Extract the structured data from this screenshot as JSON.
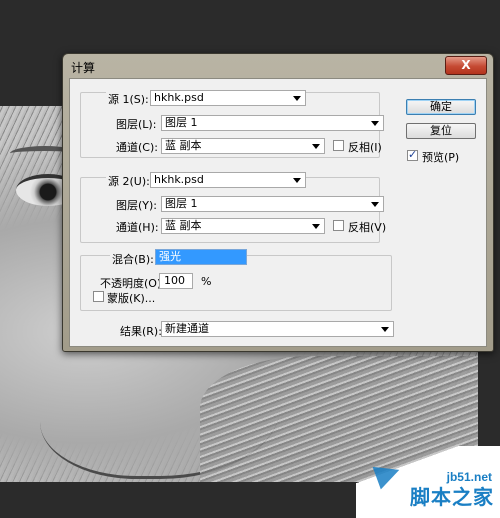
{
  "dialog": {
    "title": "计算",
    "close_label": "X"
  },
  "source1": {
    "label": "源 1(S):",
    "file": "hkhk.psd",
    "layer_label": "图层(L):",
    "layer": "图层 1",
    "channel_label": "通道(C):",
    "channel": "蓝 副本",
    "invert_label": "反相(I)",
    "invert_checked": false
  },
  "source2": {
    "label": "源 2(U):",
    "file": "hkhk.psd",
    "layer_label": "图层(Y):",
    "layer": "图层 1",
    "channel_label": "通道(H):",
    "channel": "蓝 副本",
    "invert_label": "反相(V)",
    "invert_checked": false
  },
  "blend": {
    "label": "混合(B):",
    "mode": "强光",
    "opacity_label": "不透明度(O):",
    "opacity_value": "100",
    "opacity_unit": "%",
    "mask_label": "蒙版(K)...",
    "mask_checked": false
  },
  "result": {
    "label": "结果(R):",
    "value": "新建通道"
  },
  "buttons": {
    "ok": "确定",
    "reset": "复位",
    "preview": "预览(P)",
    "preview_checked": true
  },
  "watermark": {
    "url": "jb51.net",
    "name": "脚本之家"
  }
}
